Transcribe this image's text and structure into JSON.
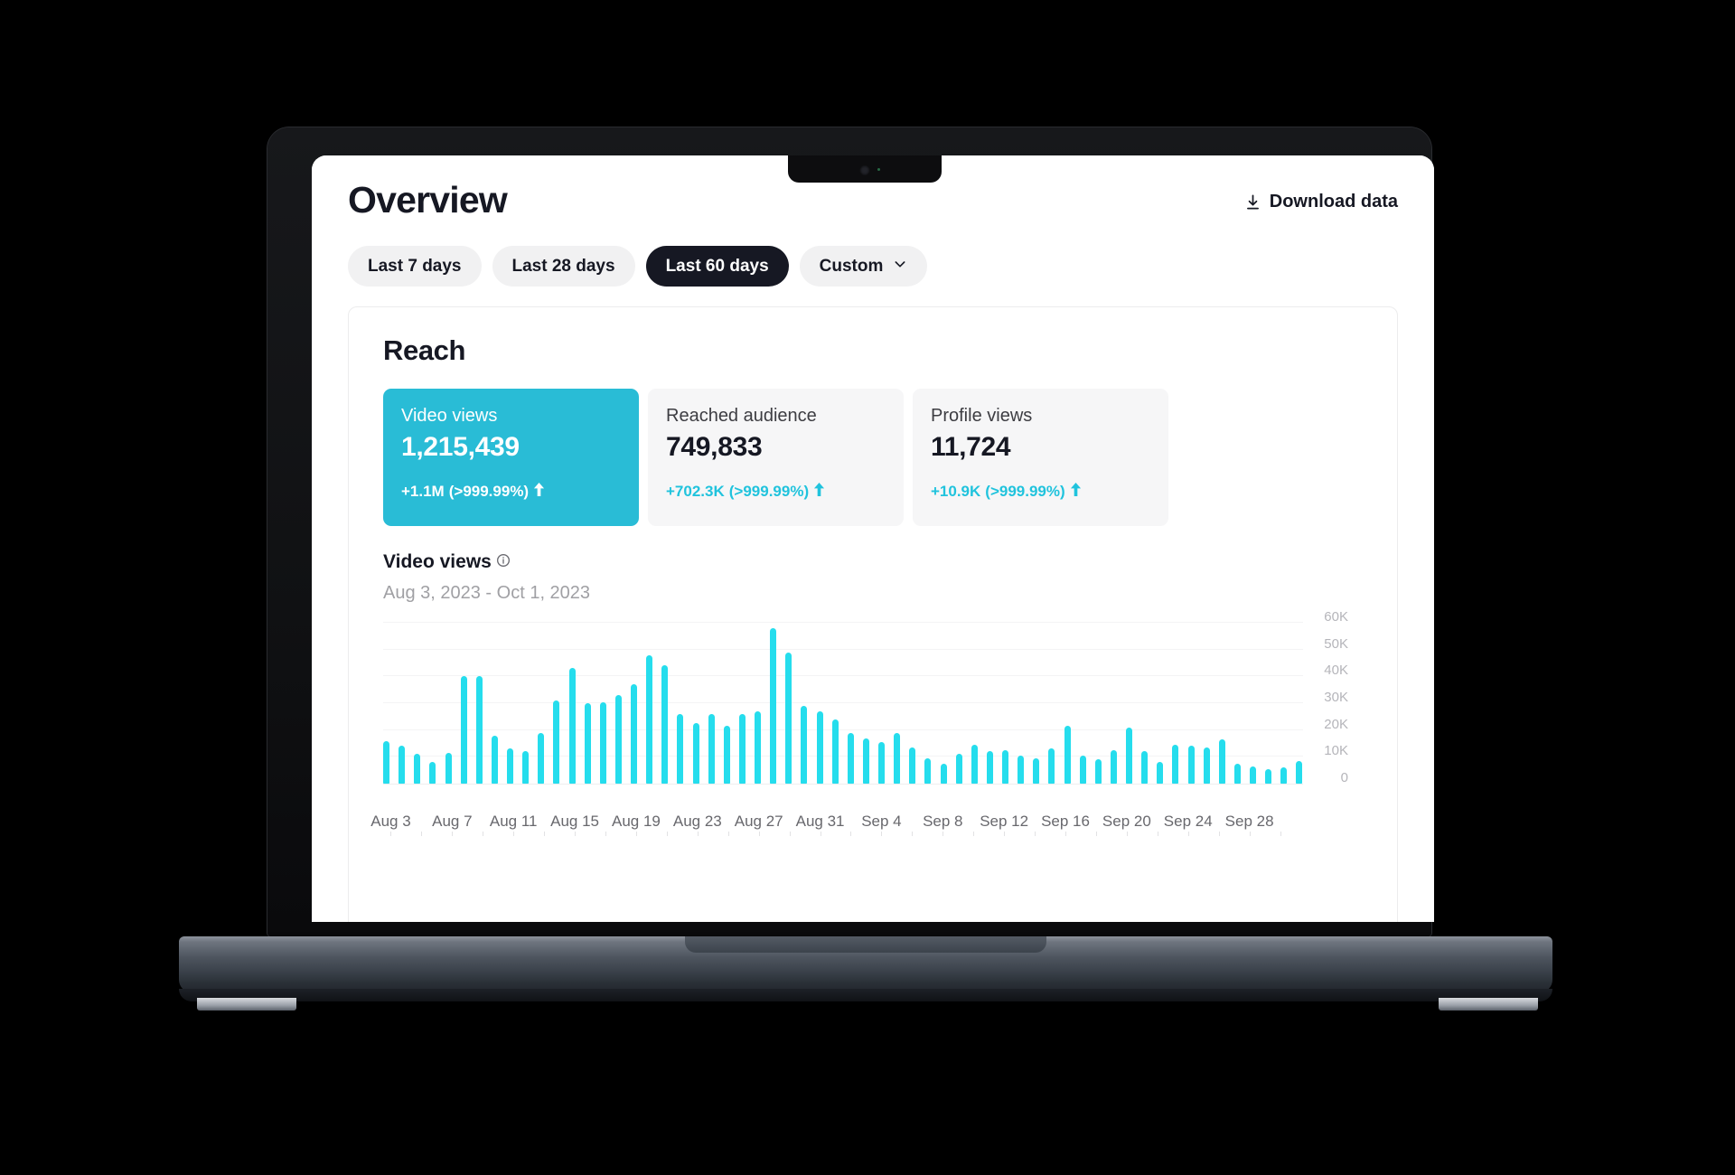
{
  "header": {
    "title": "Overview",
    "download_label": "Download data",
    "download_icon": "download-icon"
  },
  "filters": {
    "items": [
      {
        "label": "Last 7 days",
        "active": false,
        "has_chevron": false
      },
      {
        "label": "Last 28 days",
        "active": false,
        "has_chevron": false
      },
      {
        "label": "Last 60 days",
        "active": true,
        "has_chevron": false
      },
      {
        "label": "Custom",
        "active": false,
        "has_chevron": true
      }
    ]
  },
  "panel": {
    "title": "Reach",
    "cards": [
      {
        "label": "Video views",
        "value": "1,215,439",
        "delta": "+1.1M",
        "delta_pct": "(>999.99%)",
        "trend": "up",
        "active": true
      },
      {
        "label": "Reached audience",
        "value": "749,833",
        "delta": "+702.3K",
        "delta_pct": "(>999.99%)",
        "trend": "up",
        "active": false
      },
      {
        "label": "Profile views",
        "value": "11,724",
        "delta": "+10.9K",
        "delta_pct": "(>999.99%)",
        "trend": "up",
        "active": false
      }
    ],
    "chart_title": "Video views",
    "chart_info_icon": "info-icon",
    "chart_range": "Aug 3, 2023 - Oct 1, 2023"
  },
  "colors": {
    "accent": "#25dded",
    "accent_card": "#29bcd6",
    "delta_text": "#20c3dd",
    "ink": "#161823",
    "pill_bg": "#f1f1f2",
    "card_bg": "#f6f6f7"
  },
  "chart_data": {
    "type": "bar",
    "title": "Video views",
    "subtitle": "Aug 3, 2023 - Oct 1, 2023",
    "xlabel": "",
    "ylabel": "",
    "ylim": [
      0,
      60000
    ],
    "yticks": [
      0,
      10000,
      20000,
      30000,
      40000,
      50000,
      60000
    ],
    "ytick_labels": [
      "0",
      "10K",
      "20K",
      "30K",
      "40K",
      "50K",
      "60K"
    ],
    "grid": true,
    "legend": "none",
    "bar_color": "#25dded",
    "xtick_labels": [
      "Aug 3",
      "Aug 7",
      "Aug 11",
      "Aug 15",
      "Aug 19",
      "Aug 23",
      "Aug 27",
      "Aug 31",
      "Sep 4",
      "Sep 8",
      "Sep 12",
      "Sep 16",
      "Sep 20",
      "Sep 24",
      "Sep 28"
    ],
    "xtick_indices": [
      0,
      4,
      8,
      12,
      16,
      20,
      24,
      28,
      32,
      36,
      40,
      44,
      48,
      52,
      56
    ],
    "categories": [
      "Aug 3",
      "Aug 4",
      "Aug 5",
      "Aug 6",
      "Aug 7",
      "Aug 8",
      "Aug 9",
      "Aug 10",
      "Aug 11",
      "Aug 12",
      "Aug 13",
      "Aug 14",
      "Aug 15",
      "Aug 16",
      "Aug 17",
      "Aug 18",
      "Aug 19",
      "Aug 20",
      "Aug 21",
      "Aug 22",
      "Aug 23",
      "Aug 24",
      "Aug 25",
      "Aug 26",
      "Aug 27",
      "Aug 28",
      "Aug 29",
      "Aug 30",
      "Aug 31",
      "Sep 1",
      "Sep 2",
      "Sep 3",
      "Sep 4",
      "Sep 5",
      "Sep 6",
      "Sep 7",
      "Sep 8",
      "Sep 9",
      "Sep 10",
      "Sep 11",
      "Sep 12",
      "Sep 13",
      "Sep 14",
      "Sep 15",
      "Sep 16",
      "Sep 17",
      "Sep 18",
      "Sep 19",
      "Sep 20",
      "Sep 21",
      "Sep 22",
      "Sep 23",
      "Sep 24",
      "Sep 25",
      "Sep 26",
      "Sep 27",
      "Sep 28",
      "Sep 29",
      "Sep 30",
      "Oct 1"
    ],
    "values": [
      16000,
      14000,
      11000,
      8000,
      11500,
      40000,
      40000,
      18000,
      13000,
      12000,
      19000,
      31000,
      43000,
      30000,
      30500,
      33000,
      37000,
      48000,
      44000,
      26000,
      22500,
      26000,
      21500,
      26000,
      27000,
      58000,
      49000,
      29000,
      27000,
      24000,
      19000,
      17000,
      15500,
      19000,
      13500,
      9500,
      7500,
      11000,
      14500,
      12000,
      12500,
      10500,
      9500,
      13000,
      21500,
      10500,
      9000,
      12500,
      21000,
      12000,
      8000,
      14500,
      14000,
      13500,
      16500,
      7500,
      6500,
      5500,
      6000,
      8500
    ]
  }
}
